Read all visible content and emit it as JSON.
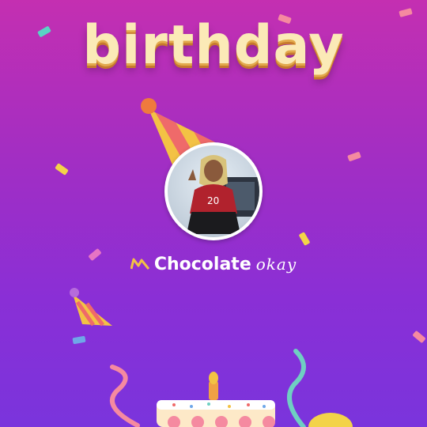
{
  "header": {
    "title": "birthday"
  },
  "profile": {
    "username": "Chocolate",
    "username_suffix": "okay",
    "badge_icon": "crown-icon"
  },
  "colors": {
    "background_top": "#c42fb1",
    "background_bottom": "#7a34dc",
    "title_fill": "#fbeab7",
    "title_shadow": "#c77a2d",
    "avatar_ring": "#ffffff",
    "badge": "#f3c244"
  }
}
